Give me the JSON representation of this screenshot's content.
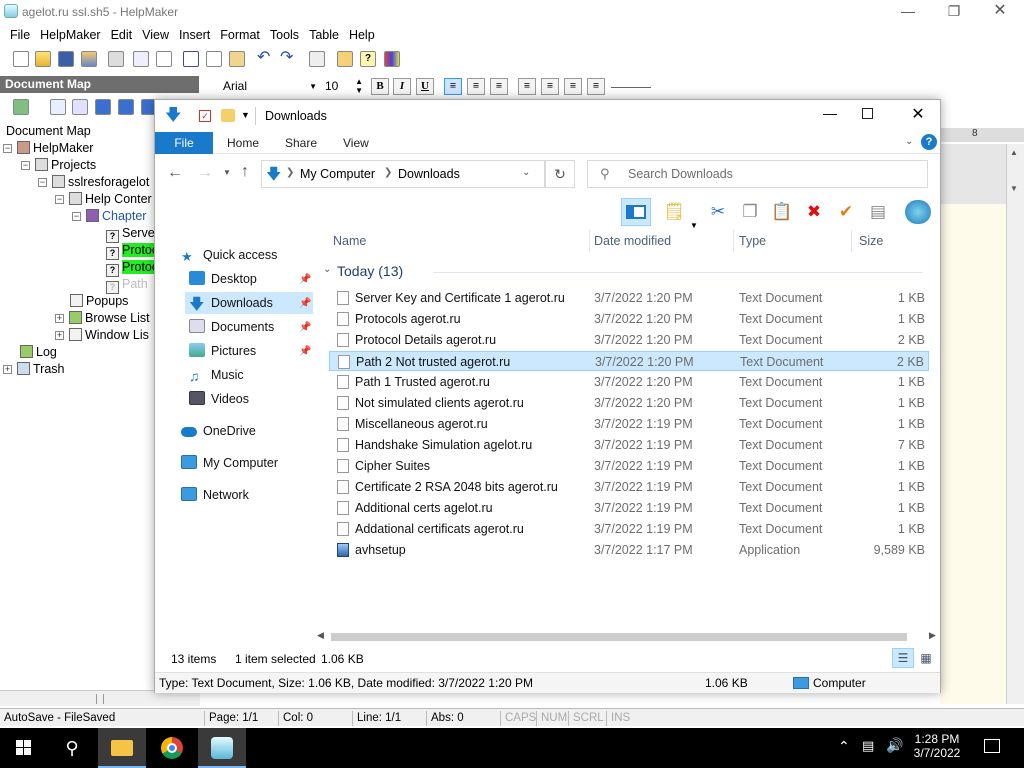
{
  "helpmaker": {
    "title": "agelot.ru ssl.sh5 - HelpMaker",
    "menu": [
      "File",
      "HelpMaker",
      "Edit",
      "View",
      "Insert",
      "Format",
      "Tools",
      "Table",
      "Help"
    ],
    "docmap_header": "Document Map",
    "docmap_label": "Document Map",
    "font_name": "Arial",
    "font_size": "10",
    "ruler_text": "8",
    "tree": {
      "root": "HelpMaker",
      "projects": "Projects",
      "project": "sslresforagelot",
      "help_contents": "Help Conter",
      "chapter": "Chapter",
      "topic1": "Serve",
      "topic2": "Protoc",
      "topic3": "Protoc",
      "topic4": "Path",
      "popups": "Popups",
      "browse_list": "Browse List",
      "window_list": "Window Lis",
      "log": "Log",
      "trash": "Trash"
    },
    "status": {
      "autosave": "AutoSave - FileSaved",
      "page": "Page: 1/1",
      "col": "Col: 0",
      "line": "Line: 1/1",
      "abs": "Abs: 0",
      "caps": "CAPS",
      "num": "NUM",
      "scrl": "SCRL",
      "ins": "INS"
    }
  },
  "explorer": {
    "title": "Downloads",
    "ribbon_tabs": [
      "File",
      "Home",
      "Share",
      "View"
    ],
    "breadcrumb": [
      "My Computer",
      "Downloads"
    ],
    "search_placeholder": "Search Downloads",
    "nav": {
      "quick_access": "Quick access",
      "desktop": "Desktop",
      "downloads": "Downloads",
      "documents": "Documents",
      "pictures": "Pictures",
      "music": "Music",
      "videos": "Videos",
      "onedrive": "OneDrive",
      "mycomputer": "My Computer",
      "network": "Network"
    },
    "columns": {
      "name": "Name",
      "date": "Date modified",
      "type": "Type",
      "size": "Size"
    },
    "group_label": "Today (13)",
    "files": [
      {
        "name": "Server Key and Certificate 1 agerot.ru",
        "date": "3/7/2022 1:20 PM",
        "type": "Text Document",
        "size": "1 KB"
      },
      {
        "name": "Protocols agerot.ru",
        "date": "3/7/2022 1:20 PM",
        "type": "Text Document",
        "size": "1 KB"
      },
      {
        "name": "Protocol Details agerot.ru",
        "date": "3/7/2022 1:20 PM",
        "type": "Text Document",
        "size": "2 KB"
      },
      {
        "name": "Path 2 Not trusted agerot.ru",
        "date": "3/7/2022 1:20 PM",
        "type": "Text Document",
        "size": "2 KB"
      },
      {
        "name": "Path 1 Trusted agerot.ru",
        "date": "3/7/2022 1:20 PM",
        "type": "Text Document",
        "size": "1 KB"
      },
      {
        "name": "Not simulated clients agerot.ru",
        "date": "3/7/2022 1:20 PM",
        "type": "Text Document",
        "size": "1 KB"
      },
      {
        "name": "Miscellaneous agerot.ru",
        "date": "3/7/2022 1:19 PM",
        "type": "Text Document",
        "size": "1 KB"
      },
      {
        "name": "Handshake Simulation agelot.ru",
        "date": "3/7/2022 1:19 PM",
        "type": "Text Document",
        "size": "7 KB"
      },
      {
        "name": "Cipher Suites",
        "date": "3/7/2022 1:19 PM",
        "type": "Text Document",
        "size": "1 KB"
      },
      {
        "name": "Certificate 2 RSA 2048 bits agerot.ru",
        "date": "3/7/2022 1:19 PM",
        "type": "Text Document",
        "size": "1 KB"
      },
      {
        "name": "Additional certs agelot.ru",
        "date": "3/7/2022 1:19 PM",
        "type": "Text Document",
        "size": "1 KB"
      },
      {
        "name": "Addational certificats  agerot.ru",
        "date": "3/7/2022 1:19 PM",
        "type": "Text Document",
        "size": "1 KB"
      },
      {
        "name": "avhsetup",
        "date": "3/7/2022 1:17 PM",
        "type": "Application",
        "size": "9,589 KB"
      }
    ],
    "selected_index": 3,
    "status_items": "13 items",
    "status_selected": "1 item selected",
    "status_size": "1.06 KB",
    "details_text": "Type: Text Document, Size: 1.06 KB, Date modified: 3/7/2022 1:20 PM",
    "details_size": "1.06 KB",
    "details_location": "Computer"
  },
  "taskbar": {
    "time": "1:28 PM",
    "date": "3/7/2022"
  },
  "colors": {
    "accent": "#1979ca",
    "selection": "#cce8ff",
    "highlight": "#22ee22"
  }
}
